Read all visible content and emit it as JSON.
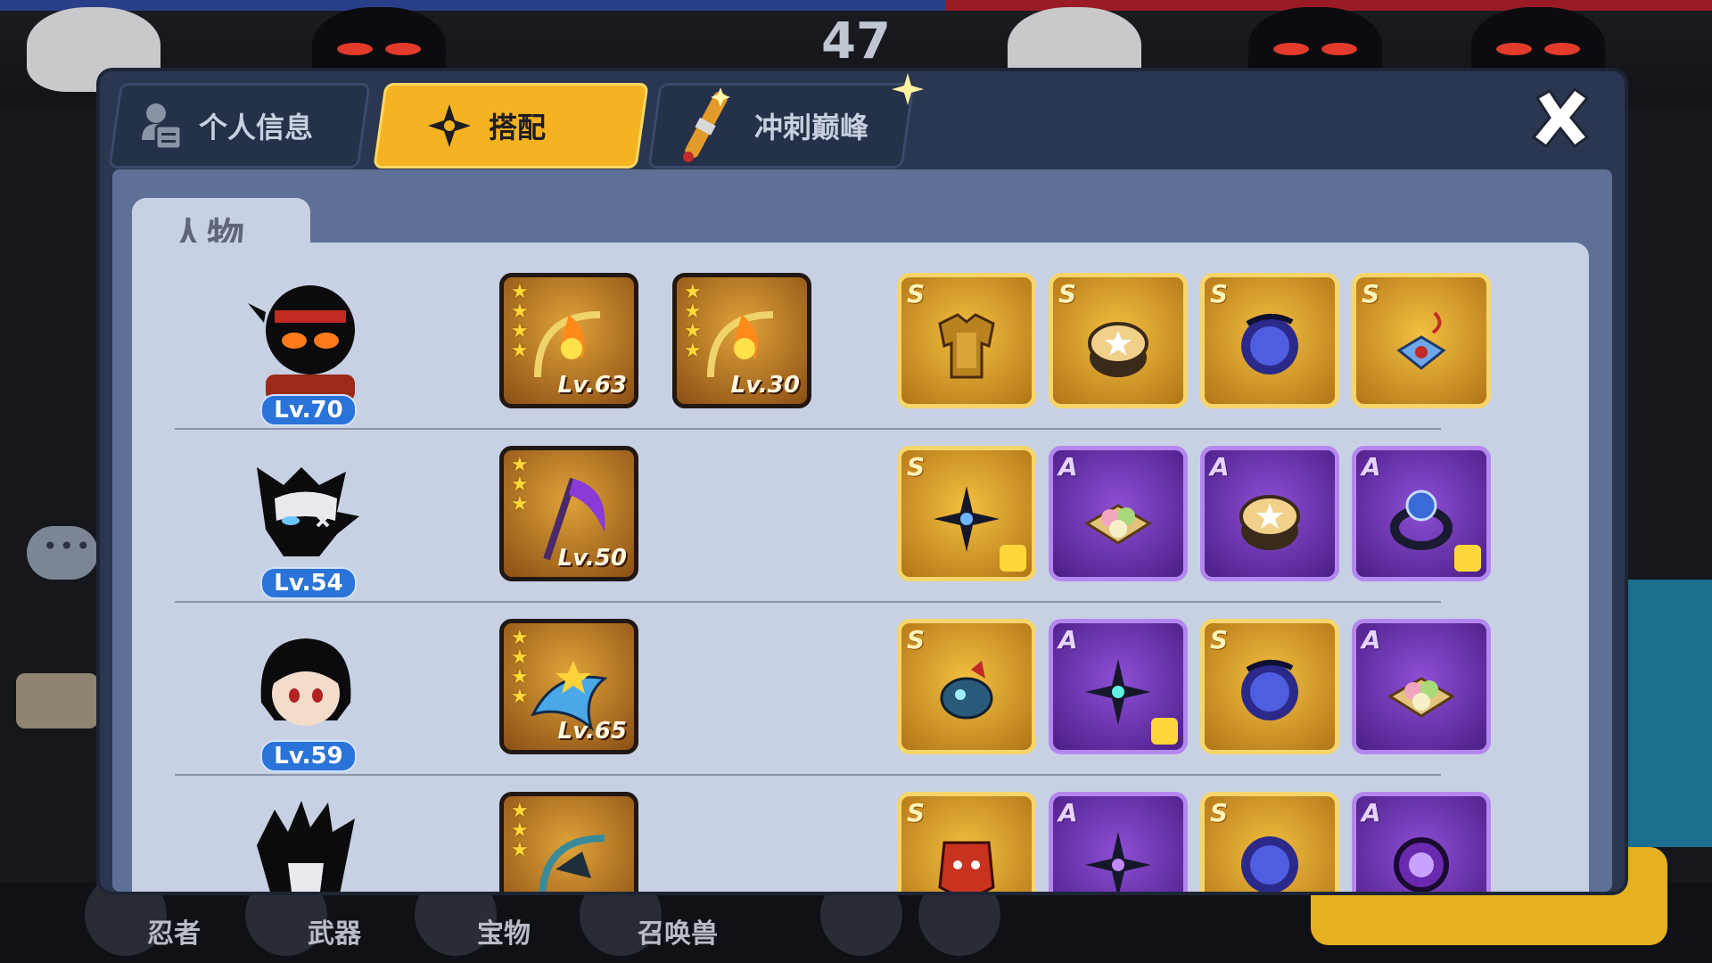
{
  "hud": {
    "score": "47",
    "bottom_nav": [
      "忍者",
      "武器",
      "宝物",
      "召唤兽"
    ],
    "chat_icon": "chat-bubble-icon",
    "bottom_right_button_visible": true
  },
  "dialog": {
    "tabs": [
      {
        "label": "个人信息",
        "icon": "person-card-icon",
        "active": false
      },
      {
        "label": "搭配",
        "icon": "shuriken-icon",
        "active": true
      },
      {
        "label": "冲刺巅峰",
        "icon": "scroll-icon",
        "active": false
      }
    ],
    "close_icon": "close-icon",
    "section_title": "人物"
  },
  "roster": [
    {
      "level": "Lv.70",
      "weapons": [
        {
          "stars": 4,
          "level": "Lv.63",
          "icon": "flame-bow-icon"
        },
        {
          "stars": 4,
          "level": "Lv.30",
          "icon": "flame-bow-icon"
        }
      ],
      "gear": [
        {
          "grade": "S",
          "icon": "armor-icon"
        },
        {
          "grade": "S",
          "icon": "drum-icon"
        },
        {
          "grade": "S",
          "icon": "dark-orb-icon"
        },
        {
          "grade": "S",
          "icon": "charm-icon"
        }
      ]
    },
    {
      "level": "Lv.54",
      "weapons": [
        {
          "stars": 3,
          "level": "Lv.50",
          "icon": "scythe-icon"
        }
      ],
      "gear": [
        {
          "grade": "S",
          "icon": "shuriken-icon",
          "badge": true
        },
        {
          "grade": "A",
          "icon": "dango-plate-icon"
        },
        {
          "grade": "A",
          "icon": "drum-icon"
        },
        {
          "grade": "A",
          "icon": "ring-icon",
          "badge": true
        }
      ]
    },
    {
      "level": "Lv.59",
      "weapons": [
        {
          "stars": 4,
          "level": "Lv.65",
          "icon": "shark-blade-icon"
        }
      ],
      "gear": [
        {
          "grade": "S",
          "icon": "fish-lantern-icon"
        },
        {
          "grade": "A",
          "icon": "shuriken-icon",
          "badge": true
        },
        {
          "grade": "S",
          "icon": "dark-orb-icon"
        },
        {
          "grade": "A",
          "icon": "dango-plate-icon"
        }
      ]
    },
    {
      "level": "",
      "weapons": [
        {
          "stars": 3,
          "level": "",
          "icon": "dragon-bow-icon"
        }
      ],
      "gear": [
        {
          "grade": "S",
          "icon": "demon-mask-icon"
        },
        {
          "grade": "A",
          "icon": "shuriken-icon"
        },
        {
          "grade": "S",
          "icon": "dark-orb-icon"
        },
        {
          "grade": "A",
          "icon": "ring-icon"
        }
      ]
    }
  ],
  "colors": {
    "active_tab": "#f5b322",
    "grade_s": "#f3c040",
    "grade_a": "#8e4fd6",
    "level_badge": "#2a73d9"
  }
}
